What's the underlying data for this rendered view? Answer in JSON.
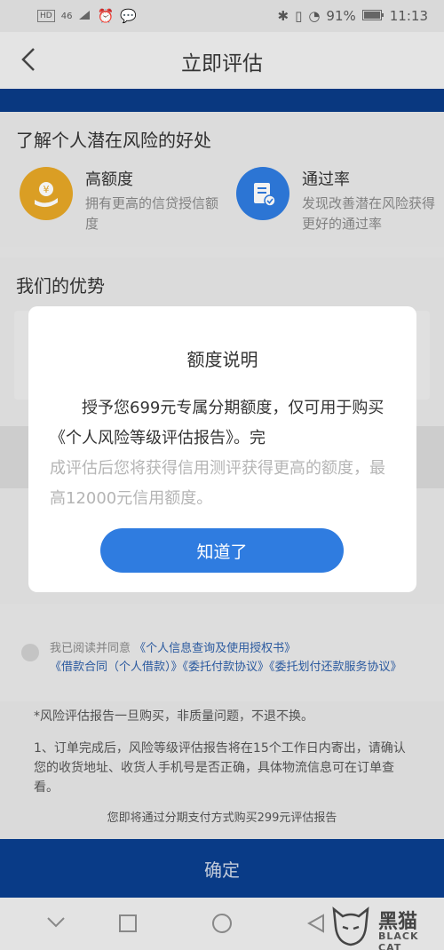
{
  "status_bar": {
    "network": "46",
    "battery": "91%",
    "time": "11:13"
  },
  "header": {
    "title": "立即评估"
  },
  "benefits": {
    "heading": "了解个人潜在风险的好处",
    "items": [
      {
        "title": "高额度",
        "desc": "拥有更高的信贷授信额度",
        "icon": "money-hand-icon",
        "color": "#e6a726"
      },
      {
        "title": "通过率",
        "desc": "发现改善潜在风险获得更好的通过率",
        "icon": "document-check-icon",
        "color": "#2f7ce0"
      }
    ]
  },
  "advantages": {
    "heading": "我们的优势"
  },
  "agreement": {
    "prefix": "我已阅读并同意",
    "links": [
      "《个人信息查询及使用授权书》",
      "《借款合同（个人借款）》",
      "《委托付款协议》",
      "《委托划付还款服务协议》"
    ]
  },
  "notes": {
    "line1": "*风险评估报告一旦购买，非质量问题，不退不换。",
    "line2": "1、订单完成后，风险等级评估报告将在15个工作日内寄出，请确认您的收货地址、收货人手机号是否正确，具体物流信息可在订单查看。",
    "line3": "您即将通过分期支付方式购买299元评估报告"
  },
  "confirm_label": "确定",
  "modal": {
    "title": "额度说明",
    "body": "授予您699元专属分期额度，仅可用于购买《个人风险等级评估报告》。完",
    "blurred": "成评估后您将获得信用测评获得更高的额度，最高12000元信用额度。",
    "button": "知道了"
  },
  "watermark": {
    "text": "黑猫",
    "sub": "BLACK CAT"
  }
}
